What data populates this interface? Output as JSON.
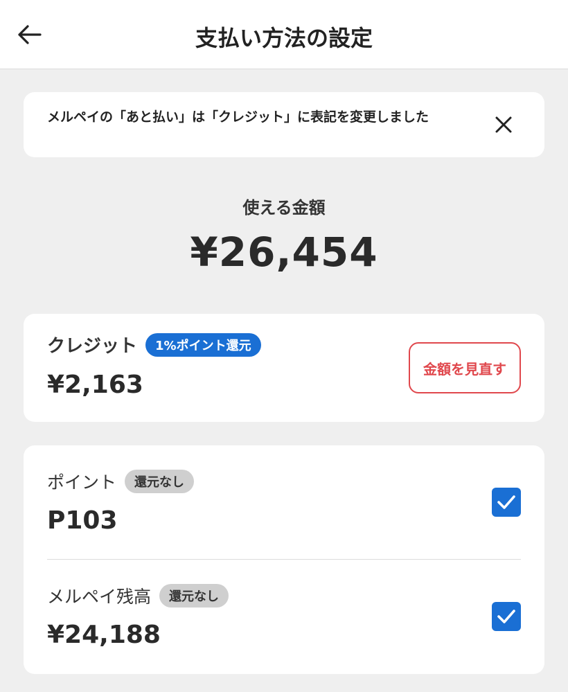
{
  "header": {
    "title": "支払い方法の設定",
    "back_icon": "arrow-left-icon"
  },
  "notice": {
    "text": "メルペイの「あと払い」は「クレジット」に表記を変更しました",
    "close_icon": "close-icon"
  },
  "balance": {
    "label": "使える金額",
    "amount": "¥26,454"
  },
  "credit": {
    "title": "クレジット",
    "badge": "1%ポイント還元",
    "amount": "¥2,163",
    "review_button": "金額を見直す"
  },
  "points": {
    "title": "ポイント",
    "badge": "還元なし",
    "amount": "P103",
    "checked": true
  },
  "merpay_balance": {
    "title": "メルペイ残高",
    "badge": "還元なし",
    "amount": "¥24,188",
    "checked": true
  },
  "colors": {
    "accent_blue": "#1a6fd4",
    "accent_red": "#e0474c",
    "background": "#efefef",
    "card": "#ffffff"
  }
}
